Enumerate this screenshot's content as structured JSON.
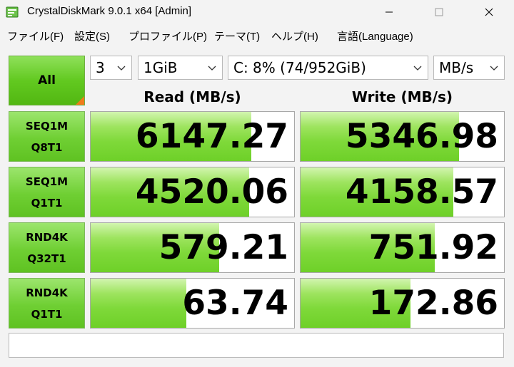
{
  "window": {
    "title": "CrystalDiskMark 9.0.1 x64 [Admin]"
  },
  "menu": [
    "ファイル(F)",
    "設定(S)",
    "プロファイル(P)",
    "テーマ(T)",
    "ヘルプ(H)",
    "言語(Language)"
  ],
  "controls": {
    "all_label": "All",
    "count": "3",
    "size": "1GiB",
    "drive": "C: 8% (74/952GiB)",
    "unit": "MB/s"
  },
  "headers": {
    "read": "Read (MB/s)",
    "write": "Write (MB/s)"
  },
  "tests": [
    {
      "line1": "SEQ1M",
      "line2": "Q8T1",
      "read": "6147.27",
      "write": "5346.98",
      "read_fill": 0.79,
      "write_fill": 0.78
    },
    {
      "line1": "SEQ1M",
      "line2": "Q1T1",
      "read": "4520.06",
      "write": "4158.57",
      "read_fill": 0.78,
      "write_fill": 0.75
    },
    {
      "line1": "RND4K",
      "line2": "Q32T1",
      "read": "579.21",
      "write": "751.92",
      "read_fill": 0.63,
      "write_fill": 0.66
    },
    {
      "line1": "RND4K",
      "line2": "Q1T1",
      "read": "63.74",
      "write": "172.86",
      "read_fill": 0.47,
      "write_fill": 0.54
    }
  ],
  "comment": "",
  "colors": {
    "accent_green": "#6ed028",
    "corner_orange": "#f07b1a"
  }
}
